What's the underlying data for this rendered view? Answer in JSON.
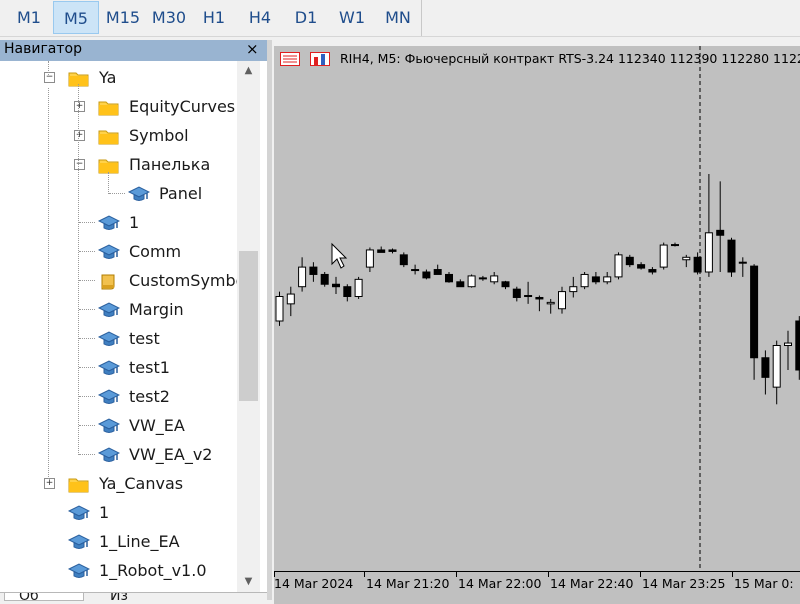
{
  "toolbar": {
    "timeframes": [
      {
        "label": "M1",
        "active": false
      },
      {
        "label": "M5",
        "active": true
      },
      {
        "label": "M15",
        "active": false
      },
      {
        "label": "M30",
        "active": false
      },
      {
        "label": "H1",
        "active": false
      },
      {
        "label": "H4",
        "active": false
      },
      {
        "label": "D1",
        "active": false
      },
      {
        "label": "W1",
        "active": false
      },
      {
        "label": "MN",
        "active": false
      }
    ]
  },
  "navigator": {
    "title": "Навигатор",
    "close_glyph": "×",
    "items": [
      {
        "label": "Ya",
        "icon": "folder-icon",
        "expanded": true
      },
      {
        "label": "EquityCurves",
        "icon": "folder-icon",
        "expanded": false
      },
      {
        "label": "Symbol",
        "icon": "folder-icon",
        "expanded": false
      },
      {
        "label": "Панелька",
        "icon": "folder-icon",
        "expanded": true
      },
      {
        "label": "Panel",
        "icon": "expert-advisor-icon"
      },
      {
        "label": "1",
        "icon": "expert-advisor-icon"
      },
      {
        "label": "Comm",
        "icon": "expert-advisor-icon"
      },
      {
        "label": "CustomSymbols",
        "icon": "script-icon"
      },
      {
        "label": "Margin",
        "icon": "expert-advisor-icon"
      },
      {
        "label": "test",
        "icon": "expert-advisor-icon"
      },
      {
        "label": "test1",
        "icon": "expert-advisor-icon"
      },
      {
        "label": "test2",
        "icon": "expert-advisor-icon"
      },
      {
        "label": "VW_EA",
        "icon": "expert-advisor-icon"
      },
      {
        "label": "VW_EA_v2",
        "icon": "expert-advisor-icon"
      },
      {
        "label": "Ya_Canvas",
        "icon": "folder-icon",
        "expanded": false
      },
      {
        "label": "1",
        "icon": "expert-advisor-icon"
      },
      {
        "label": "1_Line_EA",
        "icon": "expert-advisor-icon"
      },
      {
        "label": "1_Robot_v1.0",
        "icon": "expert-advisor-icon"
      }
    ],
    "tabs": [
      "Об",
      "Из"
    ]
  },
  "chart": {
    "caption": "RIH4, M5:  Фьючерсный контракт RTS-3.24   112340  112390  112280  112280",
    "colors": {
      "background": "#c0c0c0",
      "bull_fill": "#ffffff",
      "bear_fill": "#000000",
      "outline": "#000000"
    }
  },
  "chart_data": {
    "type": "candlestick",
    "symbol": "RIH4",
    "timeframe": "M5",
    "x_tick_labels": [
      "14 Mar 2024",
      "14 Mar 21:20",
      "14 Mar 22:00",
      "14 Mar 22:40",
      "14 Mar 23:25",
      "15 Mar 0:"
    ],
    "ohlc_window": [
      112200,
      113200
    ],
    "candles": [
      {
        "o": 112700,
        "h": 112760,
        "l": 112690,
        "c": 112750
      },
      {
        "o": 112735,
        "h": 112770,
        "l": 112710,
        "c": 112755
      },
      {
        "o": 112770,
        "h": 112830,
        "l": 112760,
        "c": 112810
      },
      {
        "o": 112810,
        "h": 112820,
        "l": 112780,
        "c": 112795
      },
      {
        "o": 112795,
        "h": 112800,
        "l": 112770,
        "c": 112775
      },
      {
        "o": 112775,
        "h": 112790,
        "l": 112755,
        "c": 112770
      },
      {
        "o": 112770,
        "h": 112775,
        "l": 112740,
        "c": 112750
      },
      {
        "o": 112750,
        "h": 112790,
        "l": 112745,
        "c": 112785
      },
      {
        "o": 112810,
        "h": 112850,
        "l": 112800,
        "c": 112845
      },
      {
        "o": 112845,
        "h": 112852,
        "l": 112840,
        "c": 112840
      },
      {
        "o": 112845,
        "h": 112848,
        "l": 112838,
        "c": 112842
      },
      {
        "o": 112835,
        "h": 112840,
        "l": 112810,
        "c": 112815
      },
      {
        "o": 112805,
        "h": 112815,
        "l": 112795,
        "c": 112805
      },
      {
        "o": 112800,
        "h": 112805,
        "l": 112785,
        "c": 112788
      },
      {
        "o": 112805,
        "h": 112815,
        "l": 112795,
        "c": 112795
      },
      {
        "o": 112795,
        "h": 112800,
        "l": 112778,
        "c": 112780
      },
      {
        "o": 112780,
        "h": 112785,
        "l": 112770,
        "c": 112770
      },
      {
        "o": 112770,
        "h": 112795,
        "l": 112768,
        "c": 112792
      },
      {
        "o": 112788,
        "h": 112792,
        "l": 112782,
        "c": 112786
      },
      {
        "o": 112780,
        "h": 112800,
        "l": 112775,
        "c": 112792
      },
      {
        "o": 112780,
        "h": 112782,
        "l": 112765,
        "c": 112770
      },
      {
        "o": 112765,
        "h": 112770,
        "l": 112740,
        "c": 112748
      },
      {
        "o": 112752,
        "h": 112780,
        "l": 112735,
        "c": 112750
      },
      {
        "o": 112748,
        "h": 112752,
        "l": 112720,
        "c": 112745
      },
      {
        "o": 112735,
        "h": 112745,
        "l": 112715,
        "c": 112738
      },
      {
        "o": 112725,
        "h": 112770,
        "l": 112715,
        "c": 112760
      },
      {
        "o": 112760,
        "h": 112790,
        "l": 112748,
        "c": 112770
      },
      {
        "o": 112770,
        "h": 112800,
        "l": 112765,
        "c": 112795
      },
      {
        "o": 112790,
        "h": 112800,
        "l": 112775,
        "c": 112780
      },
      {
        "o": 112780,
        "h": 112800,
        "l": 112775,
        "c": 112790
      },
      {
        "o": 112790,
        "h": 112840,
        "l": 112785,
        "c": 112835
      },
      {
        "o": 112830,
        "h": 112835,
        "l": 112810,
        "c": 112815
      },
      {
        "o": 112815,
        "h": 112820,
        "l": 112805,
        "c": 112808
      },
      {
        "o": 112805,
        "h": 112810,
        "l": 112795,
        "c": 112800
      },
      {
        "o": 112810,
        "h": 112860,
        "l": 112805,
        "c": 112855
      },
      {
        "o": 112855,
        "h": 112860,
        "l": 112852,
        "c": 112856
      },
      {
        "o": 112825,
        "h": 112835,
        "l": 112810,
        "c": 112830
      },
      {
        "o": 112830,
        "h": 112840,
        "l": 112795,
        "c": 112800
      },
      {
        "o": 112800,
        "h": 113000,
        "l": 112790,
        "c": 112880
      },
      {
        "o": 112885,
        "h": 112985,
        "l": 112800,
        "c": 112875
      },
      {
        "o": 112865,
        "h": 112870,
        "l": 112790,
        "c": 112800
      },
      {
        "o": 112820,
        "h": 112830,
        "l": 112790,
        "c": 112818
      },
      {
        "o": 112812,
        "h": 112816,
        "l": 112580,
        "c": 112625
      },
      {
        "o": 112625,
        "h": 112640,
        "l": 112550,
        "c": 112585
      },
      {
        "o": 112565,
        "h": 112660,
        "l": 112530,
        "c": 112650
      },
      {
        "o": 112650,
        "h": 112680,
        "l": 112600,
        "c": 112655
      },
      {
        "o": 112700,
        "h": 112710,
        "l": 112580,
        "c": 112600
      },
      {
        "o": 112650,
        "h": 112680,
        "l": 112540,
        "c": 112660
      }
    ]
  }
}
